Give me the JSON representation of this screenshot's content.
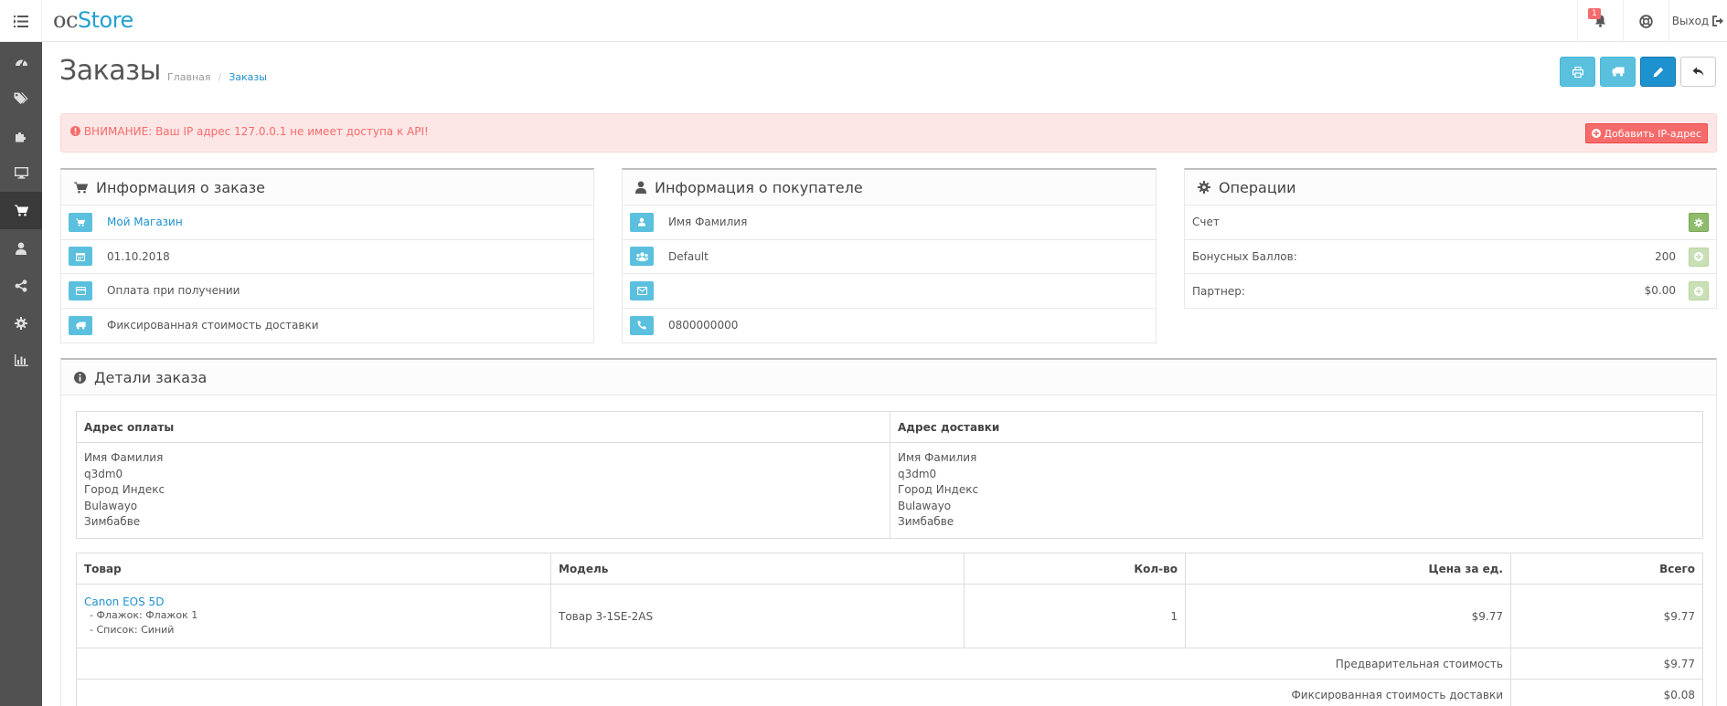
{
  "header": {
    "logo_oc": "oc",
    "logo_store": "Store",
    "notification_count": "1",
    "logout_label": "Выход"
  },
  "sidebar": {
    "items": [
      {
        "name": "dashboard",
        "icon": "tachometer-icon"
      },
      {
        "name": "catalog",
        "icon": "tags-icon"
      },
      {
        "name": "extensions",
        "icon": "puzzle-icon"
      },
      {
        "name": "design",
        "icon": "desktop-icon"
      },
      {
        "name": "sales",
        "icon": "cart-icon",
        "active": true
      },
      {
        "name": "customers",
        "icon": "user-icon"
      },
      {
        "name": "marketing",
        "icon": "share-icon"
      },
      {
        "name": "system",
        "icon": "gear-icon"
      },
      {
        "name": "reports",
        "icon": "bar-chart-icon"
      }
    ]
  },
  "page": {
    "title": "Заказы",
    "breadcrumb": [
      "Главная",
      "Заказы"
    ]
  },
  "alert": {
    "text": "ВНИМАНИЕ: Ваш IP адрес 127.0.0.1 не имеет доступа к API!",
    "button_label": "Добавить IP-адрес"
  },
  "order_info": {
    "title": "Информация о заказе",
    "store": "Мой Магазин",
    "date": "01.10.2018",
    "payment": "Оплата при получении",
    "shipping": "Фиксированная стоимость доставки"
  },
  "customer_info": {
    "title": "Информация о покупателе",
    "name": "Имя Фамилия",
    "group": "Default",
    "email": "",
    "phone": "0800000000"
  },
  "operations": {
    "title": "Операции",
    "invoice_label": "Счет",
    "reward_label": "Бонусных Баллов:",
    "reward_value": "200",
    "affiliate_label": "Партнер:",
    "affiliate_value": "$0.00"
  },
  "details": {
    "title": "Детали заказа",
    "payment_address_header": "Адрес оплаты",
    "shipping_address_header": "Адрес доставки",
    "payment_address": [
      "Имя Фамилия",
      "q3dm0",
      "Город Индекс",
      "Bulawayo",
      "Зимбабве"
    ],
    "shipping_address": [
      "Имя Фамилия",
      "q3dm0",
      "Город Индекс",
      "Bulawayo",
      "Зимбабве"
    ],
    "columns": {
      "product": "Товар",
      "model": "Модель",
      "qty": "Кол-во",
      "price": "Цена за ед.",
      "total": "Всего"
    },
    "product": {
      "name": "Canon EOS 5D",
      "option1": "- Флажок: Флажок 1",
      "option2": "- Список: Синий",
      "model": "Товар 3-1SE-2AS",
      "qty": "1",
      "price": "$9.77",
      "total": "$9.77"
    },
    "totals": [
      {
        "label": "Предварительная стоимость",
        "value": "$9.77"
      },
      {
        "label": "Фиксированная стоимость доставки",
        "value": "$0.08"
      }
    ]
  }
}
